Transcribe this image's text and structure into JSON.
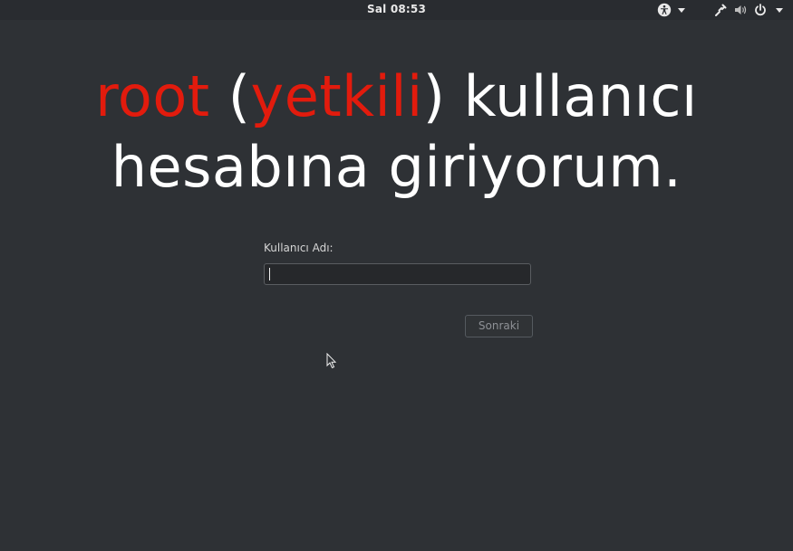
{
  "topbar": {
    "clock": "Sal 08:53",
    "icons": [
      "accessibility-icon",
      "network-icon",
      "volume-icon",
      "power-icon"
    ]
  },
  "headline": {
    "word1": "root",
    "paren_open": " (",
    "word2": "yetkili",
    "paren_close": ")",
    "rest_line1": " kullanıcı",
    "line2": "hesabına giriyorum.",
    "accent_color": "#e21b0d"
  },
  "login": {
    "username_label": "Kullanıcı Adı:",
    "username_value": "",
    "next_label": "Sonraki"
  }
}
